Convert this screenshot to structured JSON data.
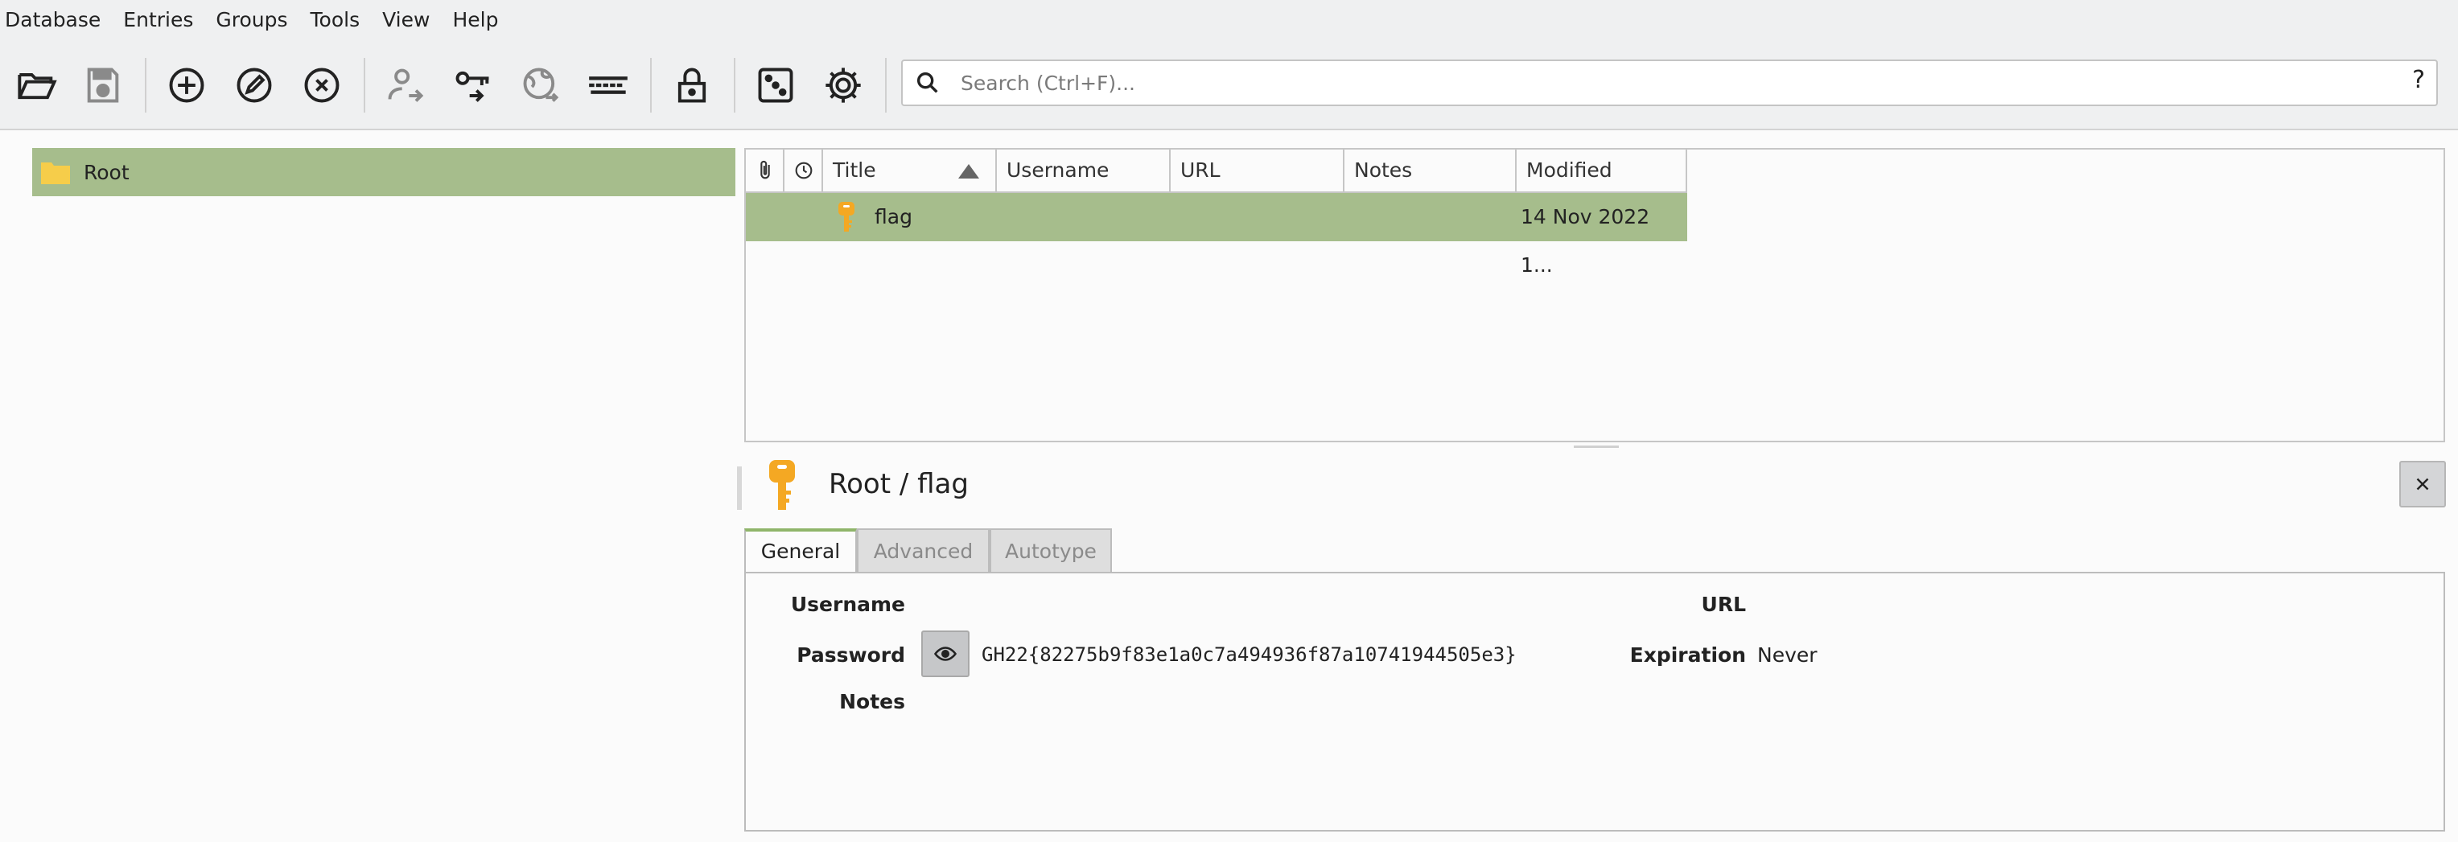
{
  "menu": [
    "Database",
    "Entries",
    "Groups",
    "Tools",
    "View",
    "Help"
  ],
  "toolbar": {
    "icons": [
      "open-database-icon",
      "save-database-icon",
      "add-entry-icon",
      "edit-entry-icon",
      "delete-entry-icon",
      "copy-username-icon",
      "copy-password-icon",
      "copy-url-icon",
      "autotype-icon",
      "lock-database-icon",
      "password-generator-icon",
      "settings-icon"
    ]
  },
  "search": {
    "placeholder": "Search (Ctrl+F)...",
    "help": "?"
  },
  "groups": [
    {
      "label": "Root",
      "selected": true
    }
  ],
  "table": {
    "columns": [
      "",
      "",
      "Title",
      "Username",
      "URL",
      "Notes",
      "Modified"
    ],
    "sort_column": "Title",
    "rows": [
      {
        "title": "flag",
        "username": "",
        "url": "",
        "notes": "",
        "modified": "14 Nov 2022 1..."
      }
    ]
  },
  "detail": {
    "title": "Root / flag",
    "tabs": [
      "General",
      "Advanced",
      "Autotype"
    ],
    "active_tab": "General",
    "fields": {
      "username_label": "Username",
      "username_value": "",
      "password_label": "Password",
      "password_value": "GH22{82275b9f83e1a0c7a494936f87a10741944505e3}",
      "notes_label": "Notes",
      "url_label": "URL",
      "url_value": "",
      "expiration_label": "Expiration",
      "expiration_value": "Never"
    }
  },
  "colors": {
    "selection": "#a6bd8c",
    "key_icon": "#f4a823",
    "folder_icon": "#f6cd4a"
  }
}
